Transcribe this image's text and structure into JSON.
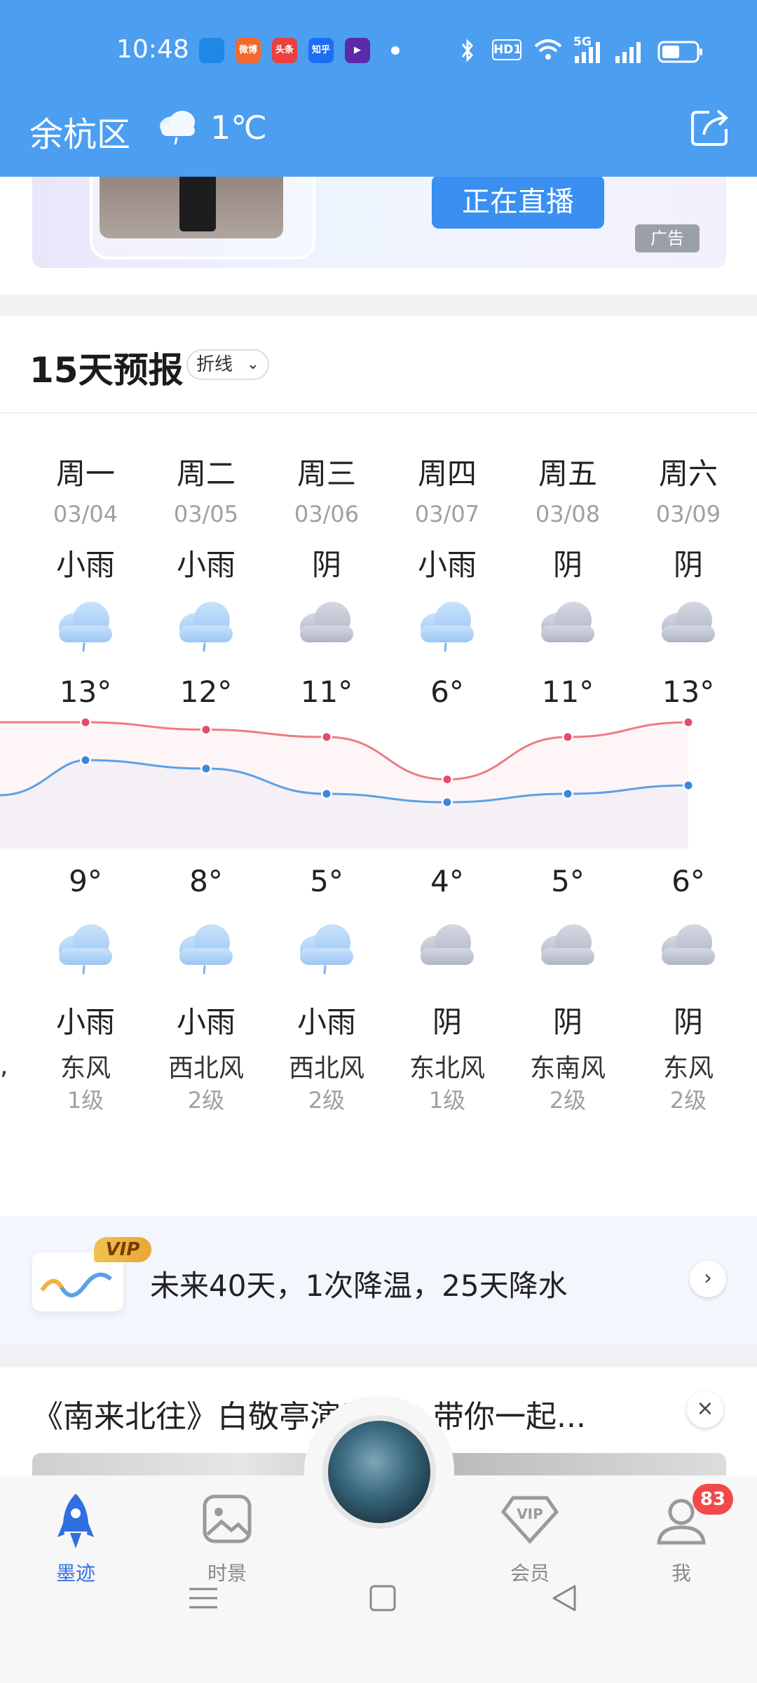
{
  "status_bar": {
    "time": "10:48",
    "apps": [
      {
        "name": "blue-app-icon",
        "color": "#1e88e5",
        "label": ""
      },
      {
        "name": "weibo-icon",
        "color": "#f26a2f",
        "label": "微博"
      },
      {
        "name": "toutiao-icon",
        "color": "#e94040",
        "label": "头条"
      },
      {
        "name": "zhihu-icon",
        "color": "#1c6ff2",
        "label": "知乎"
      },
      {
        "name": "video-app-icon",
        "color": "#5b2aa8",
        "label": "▶"
      }
    ],
    "hd_label": "HD1",
    "network_label": "5G"
  },
  "header": {
    "location": "余杭区",
    "current_temp": "1℃"
  },
  "ad": {
    "live_label": "正在直播",
    "ad_tag": "广告"
  },
  "forecast": {
    "title": "15天预报",
    "view_toggle": "折线",
    "days": [
      {
        "weekday": "周一",
        "date": "03/04",
        "day_cond": "小雨",
        "day_icon": "light-rain-icon",
        "high": "13°",
        "low": "9°",
        "night_icon": "light-rain-icon",
        "night_cond": "小雨",
        "wind": "东风",
        "level": "1级"
      },
      {
        "weekday": "周二",
        "date": "03/05",
        "day_cond": "小雨",
        "day_icon": "light-rain-icon",
        "high": "12°",
        "low": "8°",
        "night_icon": "light-rain-icon",
        "night_cond": "小雨",
        "wind": "西北风",
        "level": "2级"
      },
      {
        "weekday": "周三",
        "date": "03/06",
        "day_cond": "阴",
        "day_icon": "overcast-icon",
        "high": "11°",
        "low": "5°",
        "night_icon": "light-rain-icon",
        "night_cond": "小雨",
        "wind": "西北风",
        "level": "2级"
      },
      {
        "weekday": "周四",
        "date": "03/07",
        "day_cond": "小雨",
        "day_icon": "light-rain-icon",
        "high": "6°",
        "low": "4°",
        "night_icon": "overcast-icon",
        "night_cond": "阴",
        "wind": "东北风",
        "level": "1级"
      },
      {
        "weekday": "周五",
        "date": "03/08",
        "day_cond": "阴",
        "day_icon": "overcast-icon",
        "high": "11°",
        "low": "5°",
        "night_icon": "overcast-icon",
        "night_cond": "阴",
        "wind": "东南风",
        "level": "2级"
      },
      {
        "weekday": "周六",
        "date": "03/09",
        "day_cond": "阴",
        "day_icon": "overcast-icon",
        "high": "13°",
        "low": "6°",
        "night_icon": "overcast-icon",
        "night_cond": "阴",
        "wind": "东风",
        "level": "2级"
      }
    ],
    "high_values": [
      13,
      12,
      11,
      6,
      11,
      13
    ],
    "low_values": [
      9,
      8,
      5,
      4,
      5,
      6
    ],
    "high_color": "#f07a86",
    "low_color": "#5aa1ea"
  },
  "vip_banner": {
    "badge": "VIP",
    "text": "未来40天，1次降温，25天降水"
  },
  "news": {
    "title": "《南来北往》白敬亭演乘警，带你一起..."
  },
  "bottom_nav": {
    "items": [
      {
        "label": "墨迹",
        "icon": "rocket-icon",
        "active": true
      },
      {
        "label": "时景",
        "icon": "gallery-icon",
        "active": false
      },
      {
        "label": "会员",
        "icon": "vip-diamond-icon",
        "active": false
      },
      {
        "label": "我",
        "icon": "profile-icon",
        "active": false
      }
    ],
    "badge_count": "83"
  },
  "colors": {
    "header_bg": "#4b9ef0",
    "accent_blue": "#3a8ff0",
    "badge_red": "#f24a4a"
  }
}
